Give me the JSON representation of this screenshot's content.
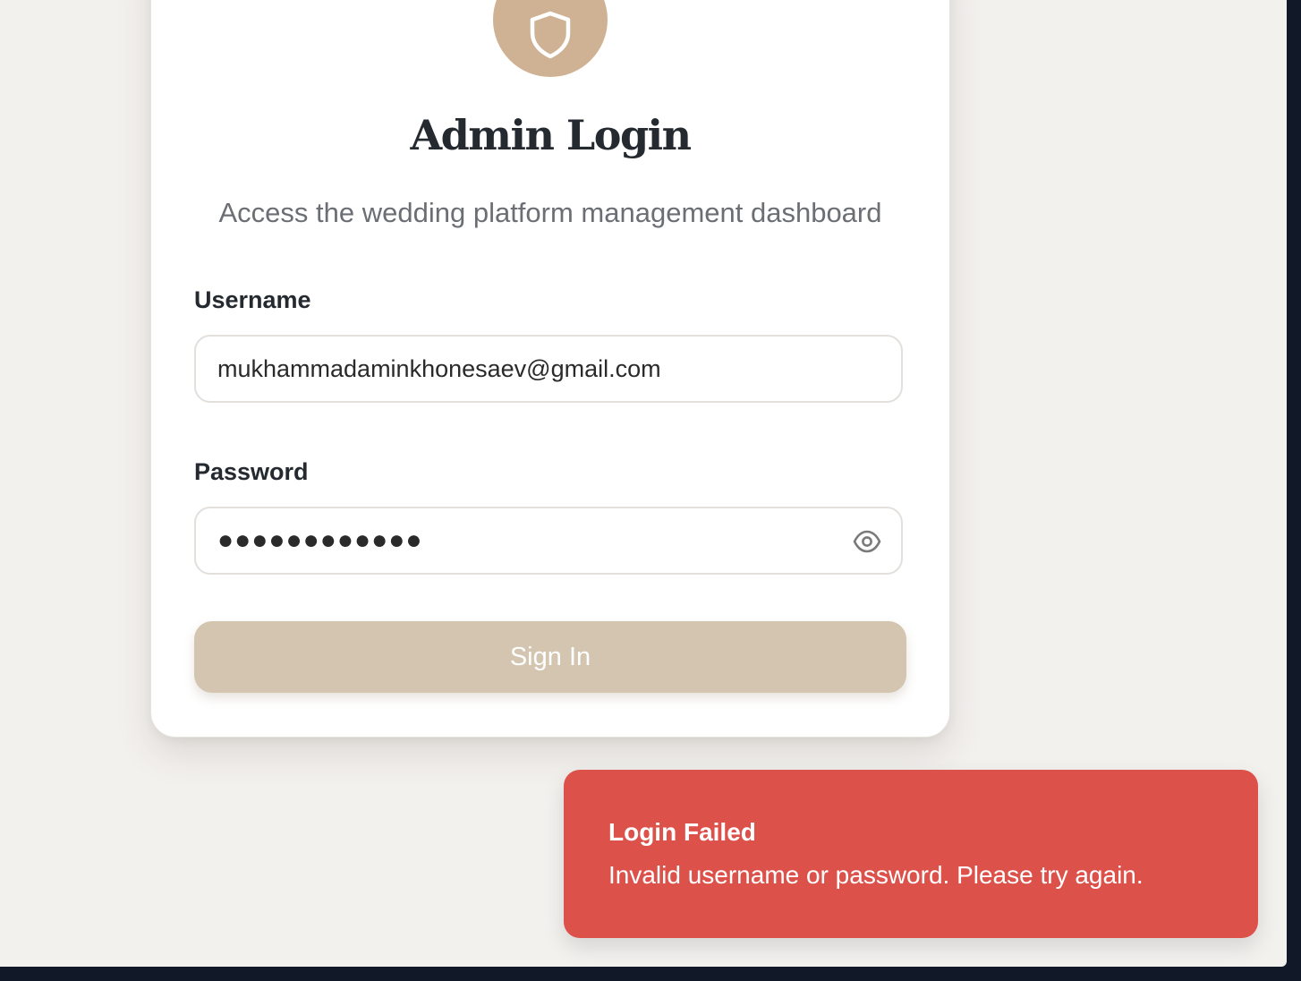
{
  "login_card": {
    "icon": "shield-icon",
    "title": "Admin Login",
    "subtitle": "Access the wedding platform management dashboard",
    "username": {
      "label": "Username",
      "value": "mukhammadaminkhonesaev@gmail.com"
    },
    "password": {
      "label": "Password",
      "masked_value": "●●●●●●●●●●●●",
      "toggle_icon": "eye-icon"
    },
    "submit_label": "Sign In"
  },
  "toast": {
    "title": "Login Failed",
    "message": "Invalid username or password. Please try again."
  },
  "colors": {
    "background": "#f3f1ee",
    "accent": "#cfb293",
    "button_disabled": "#d3c5af",
    "toast_error": "#dd514b",
    "heading": "#252a30"
  }
}
